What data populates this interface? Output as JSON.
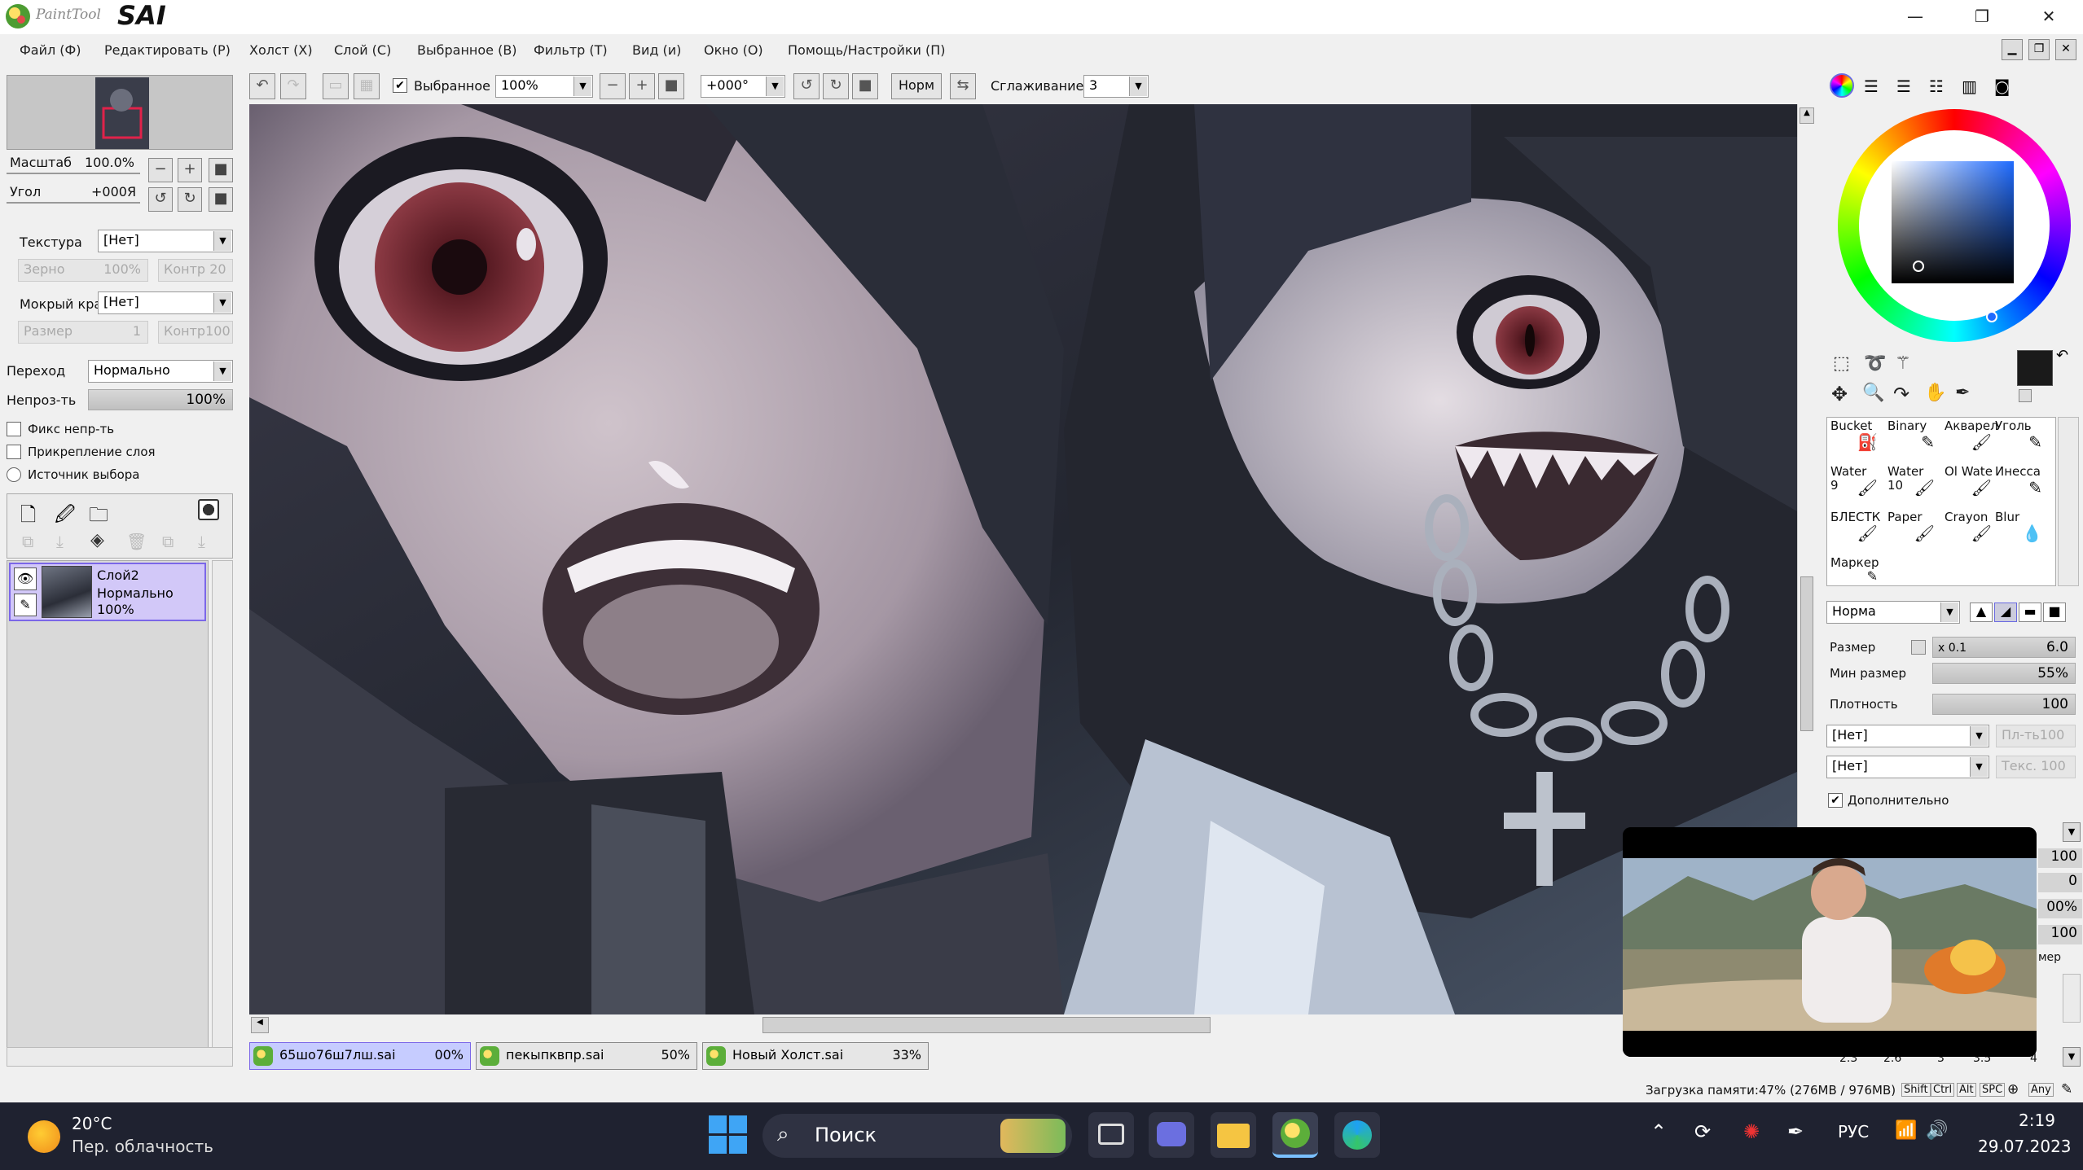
{
  "app": {
    "logo_text": "PaintTool SAI",
    "logo_small": "PaintTool",
    "logo_big": "SAI"
  },
  "window_controls": {
    "minimize": "—",
    "restore": "❐",
    "close": "✕"
  },
  "menu": [
    {
      "label": "Файл (Ф)"
    },
    {
      "label": "Редактировать (Р)"
    },
    {
      "label": "Холст (Х)"
    },
    {
      "label": "Слой (С)"
    },
    {
      "label": "Выбранное (В)"
    },
    {
      "label": "Фильтр (Т)"
    },
    {
      "label": "Вид (и)"
    },
    {
      "label": "Окно (О)"
    },
    {
      "label": "Помощь/Настройки (П)"
    }
  ],
  "navigator": {
    "zoom_label": "Масштаб",
    "zoom_value": "100.0%",
    "angle_label": "Угол",
    "angle_value": "+000Я"
  },
  "texture": {
    "label": "Текстура",
    "value": "[Нет]",
    "grain_label": "Зерно",
    "grain_value": "100%",
    "contrast_label": "Контр",
    "contrast_value": "20"
  },
  "wet_edge": {
    "label": "Мокрый край",
    "value": "[Нет]",
    "size_label": "Размер",
    "size_value": "1",
    "contrast_label": "Контр",
    "contrast_value": "100"
  },
  "layer_props": {
    "blend_label": "Переход",
    "blend_value": "Нормально",
    "opacity_label": "Непроз-ть",
    "opacity_value": "100%",
    "opacity_fraction": 1.0,
    "fix_opacity": "Фикс непр-ть",
    "clip_layer": "Прикрепление слоя",
    "selection_source": "Источник выбора"
  },
  "layers": [
    {
      "name": "Слой2",
      "mode": "Нормально",
      "opacity": "100%"
    }
  ],
  "toolbar": {
    "selection_check_label": "Выбранное",
    "zoom_value": "100%",
    "rotation_value": "+000°",
    "mode_button": "Норм",
    "stabilizer_label": "Сглаживание",
    "stabilizer_value": "3"
  },
  "doc_tabs": [
    {
      "name": "65шо76ш7лш.sai",
      "percent": "00%"
    },
    {
      "name": "пекыпквпр.sai",
      "percent": "50%"
    },
    {
      "name": "Новый Холст.sai",
      "percent": "33%"
    }
  ],
  "brushes": [
    {
      "name": "Bucket",
      "num": ""
    },
    {
      "name": "Binary",
      "num": ""
    },
    {
      "name": "Акварел",
      "num": ""
    },
    {
      "name": "Уголь",
      "num": ""
    },
    {
      "name": "Water",
      "num": "9"
    },
    {
      "name": "Water",
      "num": "10"
    },
    {
      "name": "Ol Wate",
      "num": ""
    },
    {
      "name": "Инесса",
      "num": ""
    },
    {
      "name": "БЛЕСТК",
      "num": ""
    },
    {
      "name": "Paper",
      "num": ""
    },
    {
      "name": "Crayon",
      "num": ""
    },
    {
      "name": "Blur",
      "num": ""
    },
    {
      "name": "Маркер",
      "num": ""
    }
  ],
  "brush_settings": {
    "mode_value": "Норма",
    "size_label": "Размер",
    "size_mult": "x 0.1",
    "size_value": "6.0",
    "min_size_label": "Мин размер",
    "min_size_value": "55%",
    "min_size_fraction": 0.55,
    "density_label": "Плотность",
    "density_value": "100",
    "shape_value": "[Нет]",
    "shape_strength": "Пл-ть100",
    "texture_value": "[Нет]",
    "texture_strength": "Текс. 100",
    "advanced_label": "Дополнительно",
    "hidden_values": [
      "100",
      "0",
      "00%",
      "100"
    ],
    "hidden_label": "мер",
    "size_presets": [
      "2.3",
      "2.6",
      "3",
      "3.5",
      "4"
    ]
  },
  "status": {
    "memory": "Загрузка памяти:47% (276MB / 976MB)",
    "keys": [
      "Shift",
      "Ctrl",
      "Alt",
      "SPC",
      "Any"
    ]
  },
  "taskbar": {
    "weather_temp": "20°C",
    "weather_desc": "Пер. облачность",
    "search_placeholder": "Поиск",
    "language": "РУС",
    "time": "2:19",
    "date": "29.07.2023"
  },
  "colors": {
    "primary": "#1a1a1a",
    "secondary": "#ffffff",
    "layer_selected": "#d2c8f8",
    "taskbar": "#1f2230"
  }
}
